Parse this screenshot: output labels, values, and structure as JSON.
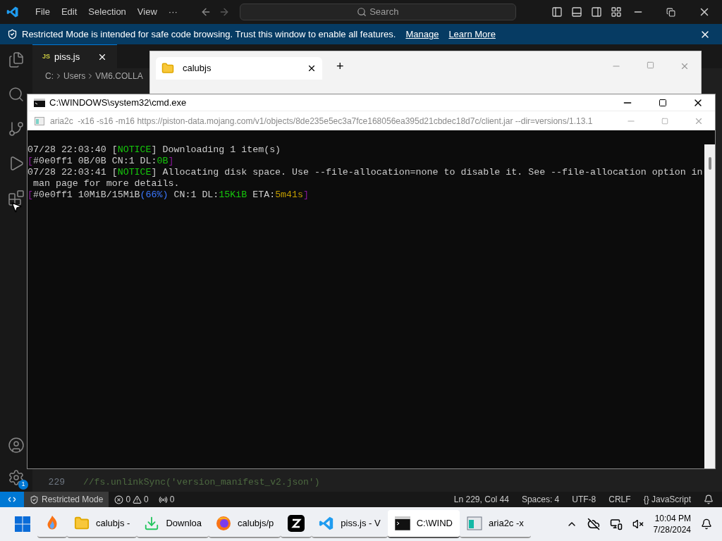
{
  "vscode": {
    "menu": [
      "File",
      "Edit",
      "Selection",
      "View",
      "···"
    ],
    "search": "Search",
    "banner": {
      "text": "Restricted Mode is intended for safe code browsing. Trust this window to enable all features.",
      "links": [
        "Manage",
        "Learn More"
      ]
    },
    "settings_badge": "1",
    "editor_tab": {
      "badge": "JS",
      "label": "piss.js"
    },
    "breadcrumb": [
      "C:",
      "Users",
      "VM6.COLLA"
    ],
    "code_line": {
      "number": "229",
      "text": "//fs.unlinkSync('version_manifest_v2.json')"
    },
    "status_bar": {
      "restricted": "Restricted Mode",
      "errors": "0",
      "warnings": "0",
      "ports": "0",
      "right": [
        "Ln 229, Col 44",
        "Spaces: 4",
        "UTF-8",
        "CRLF",
        "{} JavaScript"
      ]
    }
  },
  "explorer_window": {
    "tab": "calubjs",
    "new_tab": "+"
  },
  "cmd_window": {
    "title": "C:\\WINDOWS\\system32\\cmd.exe",
    "inner_title": "aria2c  -x16 -s16 -m16 https://piston-data.mojang.com/v1/objects/8de235e5ec3a7fce168056ea395d21cbdec18d7c/client.jar --dir=versions/1.13.1",
    "lines": [
      [
        {
          "text": "07/28 22:03:40 [",
          "color": "#cccccc"
        },
        {
          "text": "NOTICE",
          "color": "#16c60c"
        },
        {
          "text": "] Downloading 1 item(s)",
          "color": "#cccccc"
        }
      ],
      [
        {
          "text": "[",
          "color": "#881798"
        },
        {
          "text": "#0e0ff1 0B/0B CN:1 DL:",
          "color": "#cccccc"
        },
        {
          "text": "0B",
          "color": "#16c60c"
        },
        {
          "text": "]",
          "color": "#881798"
        }
      ],
      [
        {
          "text": "07/28 22:03:41 [",
          "color": "#cccccc"
        },
        {
          "text": "NOTICE",
          "color": "#16c60c"
        },
        {
          "text": "] Allocating disk space. Use --file-allocation=none to disable it. See --file-allocation option in",
          "color": "#cccccc"
        }
      ],
      [
        {
          "text": " man page for more details.",
          "color": "#cccccc"
        }
      ],
      [
        {
          "text": "[",
          "color": "#881798"
        },
        {
          "text": "#0e0ff1 10MiB/15MiB",
          "color": "#cccccc"
        },
        {
          "text": "(66%)",
          "color": "#3b78ff"
        },
        {
          "text": " CN:1 DL:",
          "color": "#cccccc"
        },
        {
          "text": "15KiB",
          "color": "#16c60c"
        },
        {
          "text": " ETA:",
          "color": "#cccccc"
        },
        {
          "text": "5m41s",
          "color": "#c19c00"
        },
        {
          "text": "]",
          "color": "#881798"
        }
      ]
    ]
  },
  "taskbar": {
    "items": [
      {
        "kind": "flame",
        "selected": false
      },
      {
        "kind": "folder",
        "label": "calubjs -",
        "selected": false
      },
      {
        "kind": "download",
        "label": "Downloa",
        "selected": false
      },
      {
        "kind": "browser",
        "label": "calubjs/p",
        "selected": false
      },
      {
        "kind": "z",
        "selected": false
      },
      {
        "kind": "vscode",
        "label": "piss.js - V",
        "selected": false
      },
      {
        "kind": "terminal",
        "label": "C:\\WIND",
        "selected": true
      },
      {
        "kind": "window",
        "label": "aria2c  -x",
        "selected": false
      }
    ],
    "time": "10:04 PM",
    "date": "7/28/2024"
  }
}
